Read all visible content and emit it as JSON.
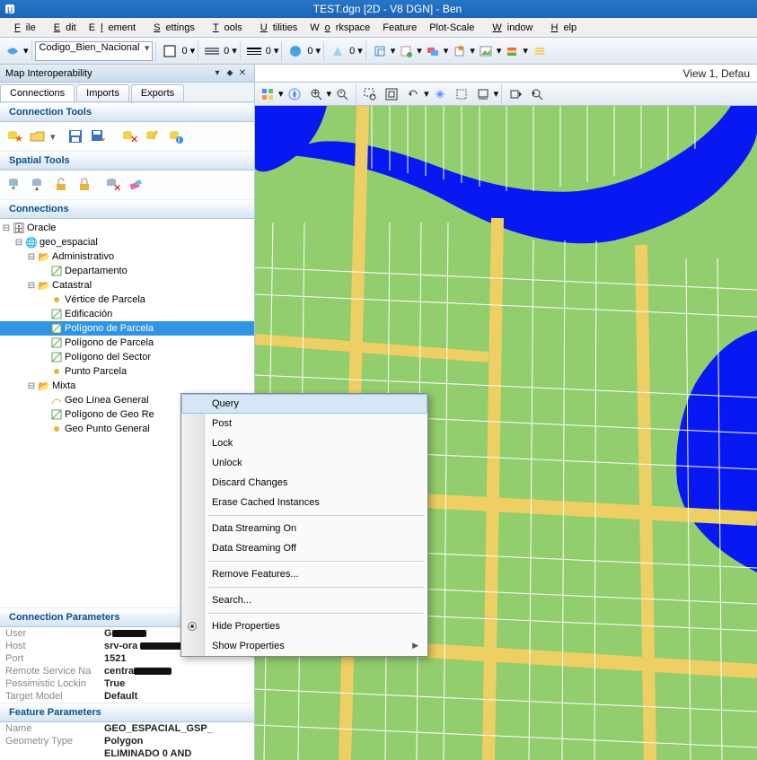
{
  "titlebar": {
    "title": "TEST.dgn [2D - V8 DGN] - Ben"
  },
  "menu": [
    "File",
    "Edit",
    "Element",
    "Settings",
    "Tools",
    "Utilities",
    "Workspace",
    "Feature",
    "Plot-Scale",
    "Window",
    "Help"
  ],
  "toolbar": {
    "sel1": "Codigo_Bien_Nacional",
    "n0": "0",
    "n1": "0",
    "n2": "0",
    "n3": "0",
    "n4": "0"
  },
  "panel": {
    "title": "Map Interoperability",
    "tabs": [
      "Connections",
      "Imports",
      "Exports"
    ],
    "sections": {
      "conn_tools": "Connection Tools",
      "spatial_tools": "Spatial Tools",
      "conns": "Connections",
      "conn_params": "Connection Parameters",
      "feat_params": "Feature Parameters"
    },
    "tree": {
      "root": "Oracle",
      "db": "geo_espacial",
      "admin": "Administrativo",
      "depto": "Departamento",
      "cat": "Catastral",
      "cat_items": [
        "Vértice de Parcela",
        "Edificación",
        "Polígono de Parcela",
        "Polígono de Parcela",
        "Polígono del Sector",
        "Punto Parcela"
      ],
      "mixta": "Mixta",
      "mixta_items": [
        "Geo Línea General",
        "Polígono de Geo Re",
        "Geo Punto General"
      ]
    },
    "params": {
      "user_lab": "User",
      "host_lab": "Host",
      "host_val": "srv-ora",
      "port_lab": "Port",
      "port_val": "1521",
      "rsn_lab": "Remote Service Na",
      "rsn_val": "centra",
      "pl_lab": "Pessimistic Lockin",
      "pl_val": "True",
      "tm_lab": "Target Model",
      "tm_val": "Default"
    },
    "feat": {
      "name_lab": "Name",
      "name_val": "GEO_ESPACIAL_GSP_",
      "gt_lab": "Geometry Type",
      "gt_val": "Polygon",
      "wc_lab": "",
      "wc_val": "ELIMINADO   0 AND "
    }
  },
  "view": {
    "title": "View 1, Defau"
  },
  "context": {
    "items": [
      "Query",
      "Post",
      "Lock",
      "Unlock",
      "Discard Changes",
      "Erase Cached Instances",
      "Data Streaming On",
      "Data Streaming Off",
      "Remove Features...",
      "Search...",
      "Hide Properties",
      "Show Properties"
    ]
  }
}
